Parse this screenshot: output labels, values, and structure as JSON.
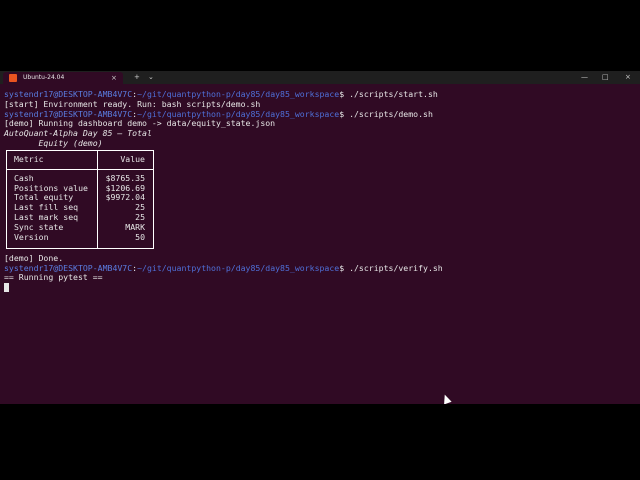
{
  "tab": {
    "title": "Ubuntu-24.04",
    "close": "×",
    "new": "+",
    "dropdown": "⌄"
  },
  "window_controls": {
    "minimize": "—",
    "maximize": "□",
    "close": "×"
  },
  "prompt": {
    "user": "systendr17@DESKTOP-AMB4V7C",
    "colon": ":",
    "path": "~/git/quantpython-p/day85/day85_workspace",
    "symbol": "$ "
  },
  "terminal": {
    "cmd1": "./scripts/start.sh",
    "out1": "[start] Environment ready. Run: bash scripts/demo.sh",
    "cmd2": "./scripts/demo.sh",
    "out2": "[demo] Running dashboard demo -> data/equity_state.json",
    "title_line1": "AutoQuant-Alpha Day 85 — Total",
    "title_line2": "       Equity (demo)",
    "table": {
      "header_metric": "Metric",
      "header_value": "Value",
      "rows": [
        {
          "metric": "Cash",
          "value": "$8765.35"
        },
        {
          "metric": "Positions value",
          "value": "$1206.69"
        },
        {
          "metric": "Total equity",
          "value": "$9972.04"
        },
        {
          "metric": "Last fill seq",
          "value": "25"
        },
        {
          "metric": "Last mark seq",
          "value": "25"
        },
        {
          "metric": "Sync state",
          "value": "MARK"
        },
        {
          "metric": "Version",
          "value": "50"
        }
      ]
    },
    "out3": "[demo] Done.",
    "cmd3": "./scripts/verify.sh",
    "out4": "== Running pytest =="
  },
  "colors": {
    "terminal_bg": "#300a24",
    "prompt_user": "#5a7ce0",
    "accent": "#e95420"
  }
}
